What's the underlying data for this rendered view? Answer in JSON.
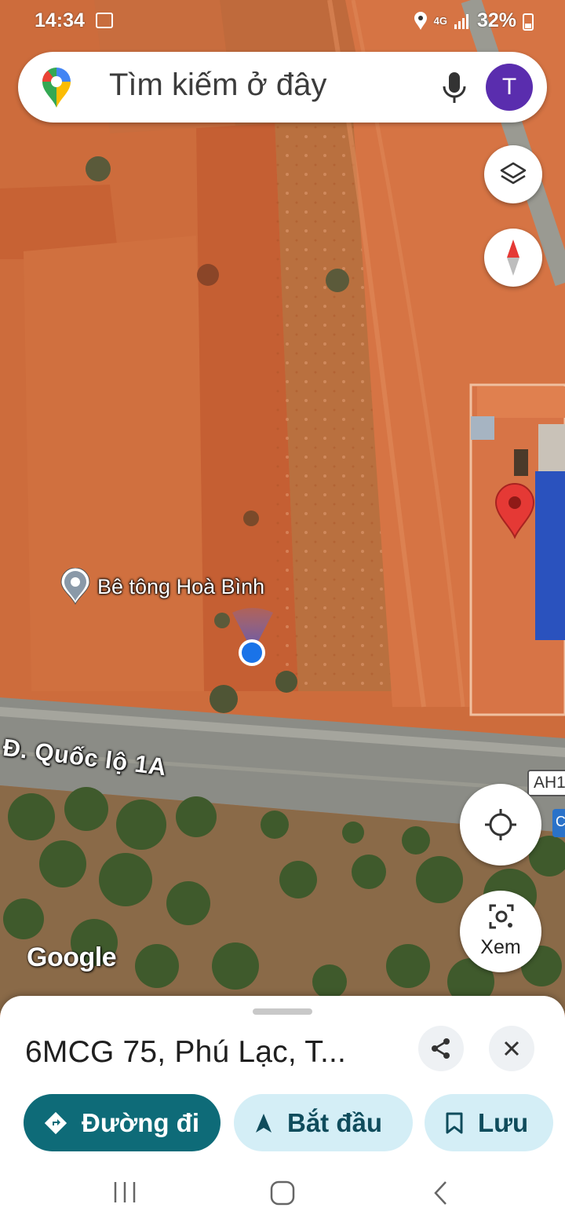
{
  "status_bar": {
    "time": "14:34",
    "network": "4G",
    "battery": "32%"
  },
  "search": {
    "placeholder": "Tìm kiếm ở đây",
    "avatar_letter": "T"
  },
  "map": {
    "place_label": "Bê tông Hoà Bình",
    "road_label": "Đ. Quốc lộ 1A",
    "highway_shield": "AH1",
    "attribution": "Google"
  },
  "controls": {
    "xem_label": "Xem"
  },
  "sheet": {
    "title": "6MCG 75, Phú Lạc, T...",
    "directions_label": "Đường đi",
    "start_label": "Bắt đầu",
    "save_label": "Lưu"
  },
  "colors": {
    "accent_teal": "#0e6b78",
    "chip_light": "#d4eef6",
    "avatar_purple": "#5a2dae",
    "pin_red": "#e53935",
    "location_blue": "#1a73e8"
  }
}
